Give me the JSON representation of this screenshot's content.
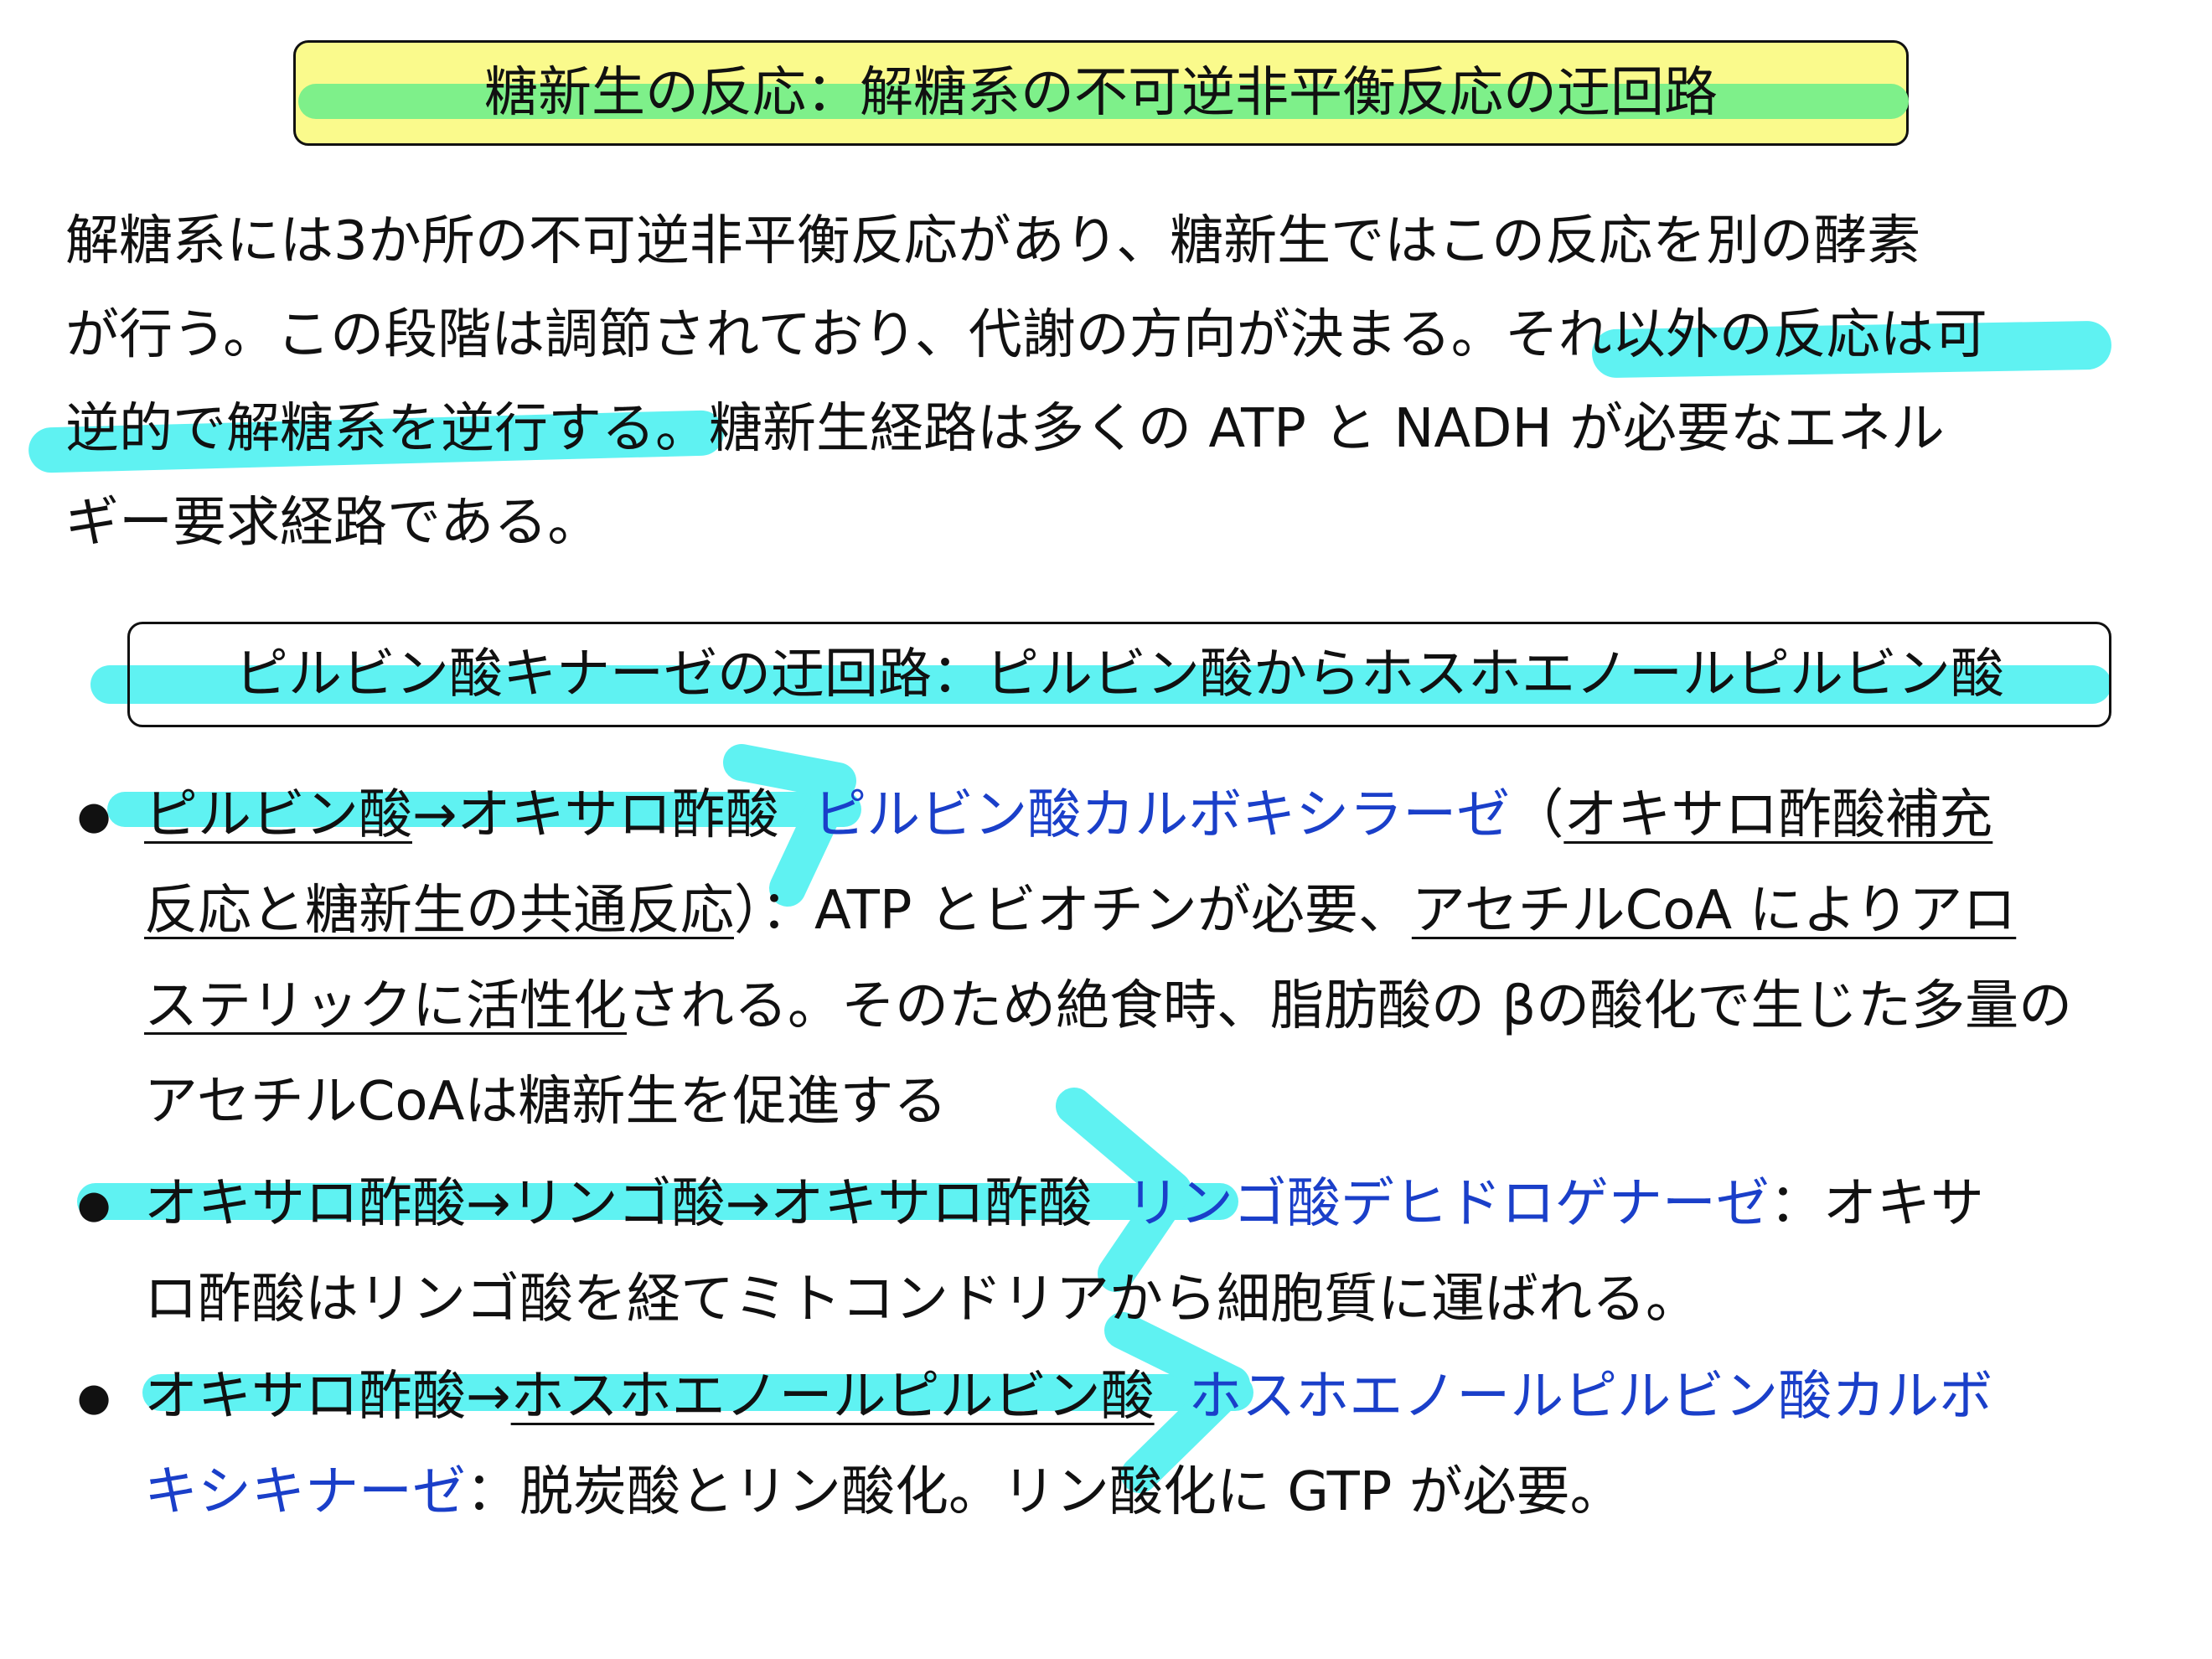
{
  "title": "糖新生の反応：解糖系の不可逆非平衡反応の迂回路",
  "paragraph": {
    "lines": [
      "解糖系には3か所の不可逆非平衡反応があり、糖新生ではこの反応を別の酵素",
      [
        "が行う。この段階は調節されており、代謝の方向が決まる。",
        "それ以外の反応は可"
      ],
      [
        "逆的で解糖系を逆行する",
        "。糖新生経路は多くの ATP と NADH が必要なエネル"
      ],
      "ギー要求経路である。"
    ]
  },
  "subtitle": "ピルビン酸キナーゼの迂回路：ピルビン酸からホスホエノールピルビン酸",
  "bullets": [
    {
      "lines": [
        [
          "ピルビン酸",
          "→オキサロ酢酸  ",
          "ピルビン酸カルボキシラーゼ",
          "（",
          "オキサロ酢酸補充"
        ],
        [
          "反応と糖新生の共通反応",
          "）：ATP とビオチンが必要、",
          "アセチルCoA によりアロ"
        ],
        [
          "ステリックに活性化",
          "される。そのため絶食時、脂肪酸の βの酸化で生じた多量の"
        ],
        [
          "アセチルCoAは糖新生を促進する"
        ]
      ]
    },
    {
      "lines": [
        [
          "オキサロ酢酸→リンゴ酸→オキサロ酢酸  ",
          "リンゴ酸デヒドロゲナーゼ",
          "：オキサ"
        ],
        [
          "ロ酢酸はリンゴ酸を経てミトコンドリアから細胞質に運ばれる。"
        ]
      ]
    },
    {
      "lines": [
        [
          "オキサロ酢酸→",
          "ホスホエノールピルビン酸",
          "  ",
          "ホスホエノールピルビン酸カルボ"
        ],
        [
          "キシキナーゼ",
          "：脱炭酸とリン酸化。リン酸化に GTP が必要。"
        ]
      ]
    }
  ],
  "bullet_symbol": "●",
  "colors": {
    "title_bg": "#fafa8c",
    "green_highlight": "#7ef08a",
    "cyan_highlight": "#5ff2f2",
    "enzyme_blue": "#1a3fc9"
  }
}
